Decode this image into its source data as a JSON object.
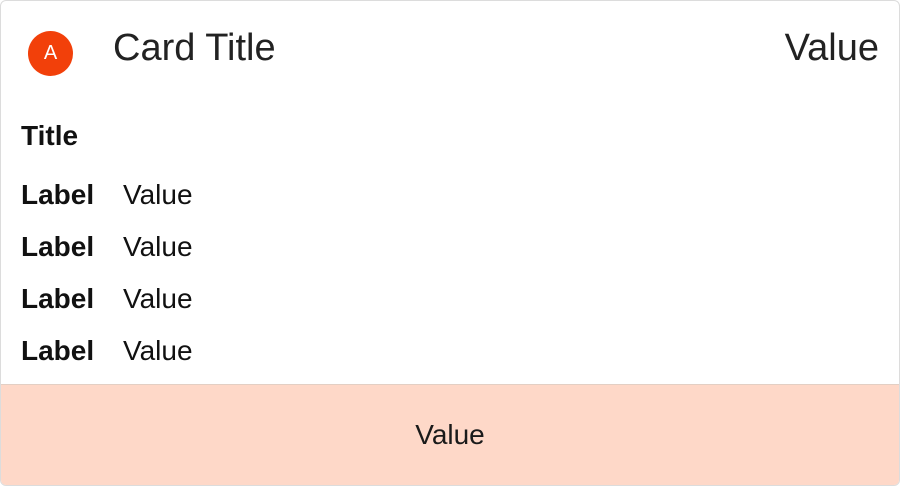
{
  "card": {
    "avatar_letter": "A",
    "title": "Card Title",
    "header_value": "Value",
    "body_title": "Title",
    "rows": [
      {
        "label": "Label",
        "value": "Value"
      },
      {
        "label": "Label",
        "value": "Value"
      },
      {
        "label": "Label",
        "value": "Value"
      },
      {
        "label": "Label",
        "value": "Value"
      }
    ],
    "footer_value": "Value"
  },
  "colors": {
    "avatar_bg": "#f2400a",
    "footer_bg": "#fed8c8",
    "border": "#dcdcdc"
  }
}
